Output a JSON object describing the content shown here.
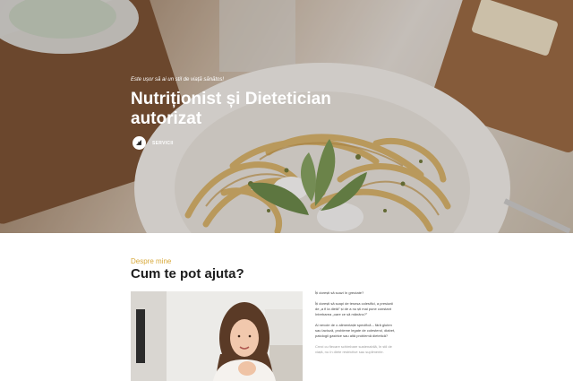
{
  "hero": {
    "tagline": "Este ușor să ai un stil de viață sănătos!",
    "title": "Nutriționist și Dietetician autorizat",
    "cta_label": "SERVICII",
    "cta_icon": "arrow-icon"
  },
  "about": {
    "eyebrow": "Despre mine",
    "title": "Cum te pot ajuta?",
    "photo_alt": "nutritionist-portrait",
    "paragraphs": [
      "Îți dorești să scazi în greutate?",
      "Îți dorești să scapi de tesnsa colesifici, a presiunii de „a fi la dietă” și de a nu ști mai pune constant întrebarea „oare ce să mănânc?”",
      "Ai nevoie de o alimentație specifică – fără gluten sau lactoză, probleme legate de colesterol, diabet, patologii gastrice sau altă problemă dietetică?",
      "Crezi cu fiecare schimbare sustenabilă, în stil de viață, nu în diete restrictive sau suplimente."
    ]
  },
  "colors": {
    "accent": "#d8a93b",
    "title_dark": "#1d1d1d",
    "hero_text": "#ffffff"
  }
}
